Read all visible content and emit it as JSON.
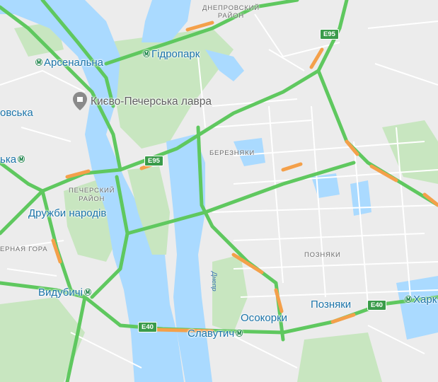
{
  "map": {
    "colors": {
      "water": "#aadaff",
      "park": "#c8e6c0",
      "land": "#ececec",
      "road_fast": "#5fc85f",
      "road_slow": "#f4a04a"
    },
    "districts": {
      "dniprovskyi_line1": "ДНЕПРОВСКИЙ",
      "dniprovskyi_line2": "РАЙОН",
      "pecherskyi_line1": "ПЕЧЕРСКИЙ",
      "pecherskyi_line2": "РАЙОН",
      "bereznyaky": "БЕРЕЗНЯКИ",
      "pozniaky": "ПОЗНЯКИ",
      "cherna_hora": "ЕРНАЯ ГОРА"
    },
    "stations": {
      "hidropark": "Гідропарк",
      "arsenalna": "Арсенальна",
      "vska": "овська",
      "ka": "ька",
      "druzhby": "Дружби народів",
      "vydubychi": "Видубичі",
      "slavutych": "Славутич",
      "osokorky": "Осокорки",
      "pozniaky": "Позняки",
      "kharkivska": "Харк"
    },
    "poi": {
      "lavra": "Києво-Печерська лавра"
    },
    "river": "Днепр",
    "shields": {
      "e95_top": "E95",
      "e95_mid": "E95",
      "e40_left": "E40",
      "e40_right": "E40"
    },
    "icons": {
      "metro": "metro-icon",
      "poi": "landmark-pin-icon"
    }
  }
}
